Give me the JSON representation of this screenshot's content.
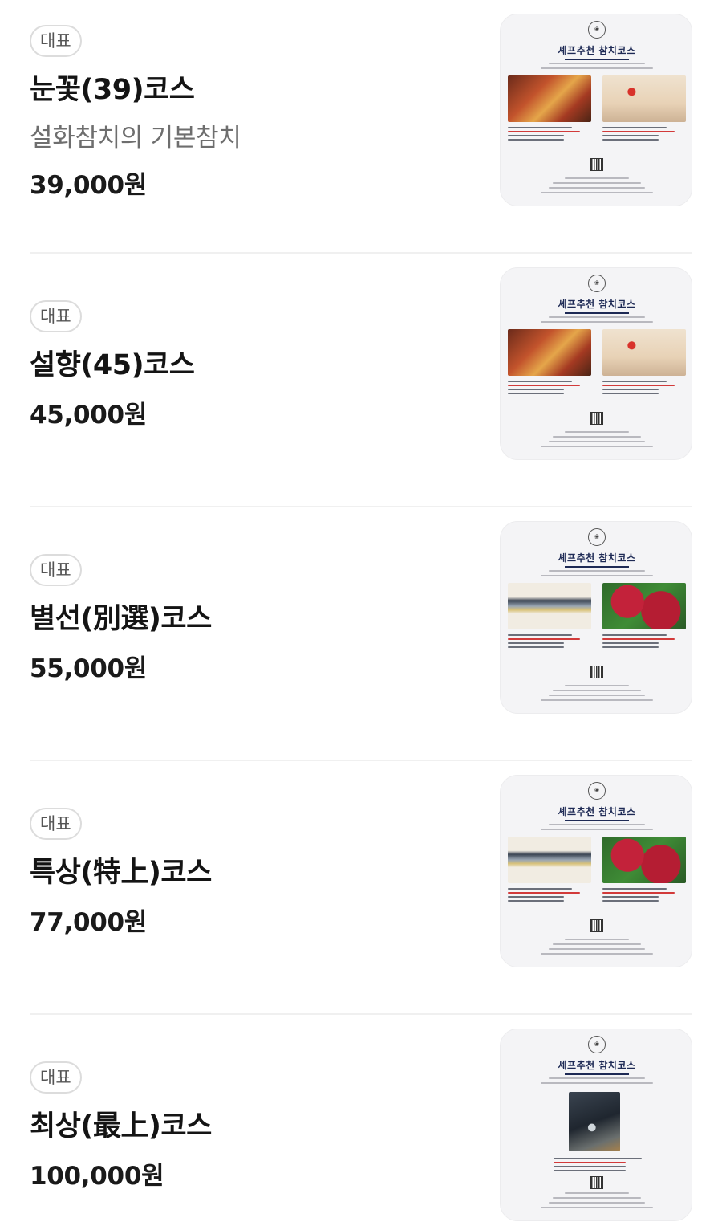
{
  "menu_items": [
    {
      "badge": "대표",
      "name": "눈꽃(39)코스",
      "description": "설화참치의 기본참치",
      "price": "39,000원",
      "thumbnail": {
        "title": "셰프추천 참치코스",
        "layout": "two-photos",
        "photos": [
          "sushi",
          "sunset"
        ]
      }
    },
    {
      "badge": "대표",
      "name": "설향(45)코스",
      "description": "",
      "price": "45,000원",
      "thumbnail": {
        "title": "셰프추천 참치코스",
        "layout": "two-photos",
        "photos": [
          "sushi",
          "sunset"
        ]
      }
    },
    {
      "badge": "대표",
      "name": "별선(別選)코스",
      "description": "",
      "price": "55,000원",
      "thumbnail": {
        "title": "셰프추천 참치코스",
        "layout": "two-photos",
        "photos": [
          "tuna",
          "raw"
        ]
      }
    },
    {
      "badge": "대표",
      "name": "특상(特上)코스",
      "description": "",
      "price": "77,000원",
      "thumbnail": {
        "title": "셰프추천 참치코스",
        "layout": "two-photos",
        "photos": [
          "tuna",
          "raw"
        ]
      }
    },
    {
      "badge": "대표",
      "name": "최상(最上)코스",
      "description": "",
      "price": "100,000원",
      "thumbnail": {
        "title": "셰프추천 참치코스",
        "layout": "one-photo",
        "photos": [
          "head"
        ]
      }
    }
  ],
  "colors": {
    "badge_border": "#dcdcdc",
    "divider": "#f0f0f0",
    "thumb_bg": "#f4f4f6",
    "poster_navy": "#1e2a55",
    "caption_red": "#d23a3a"
  }
}
